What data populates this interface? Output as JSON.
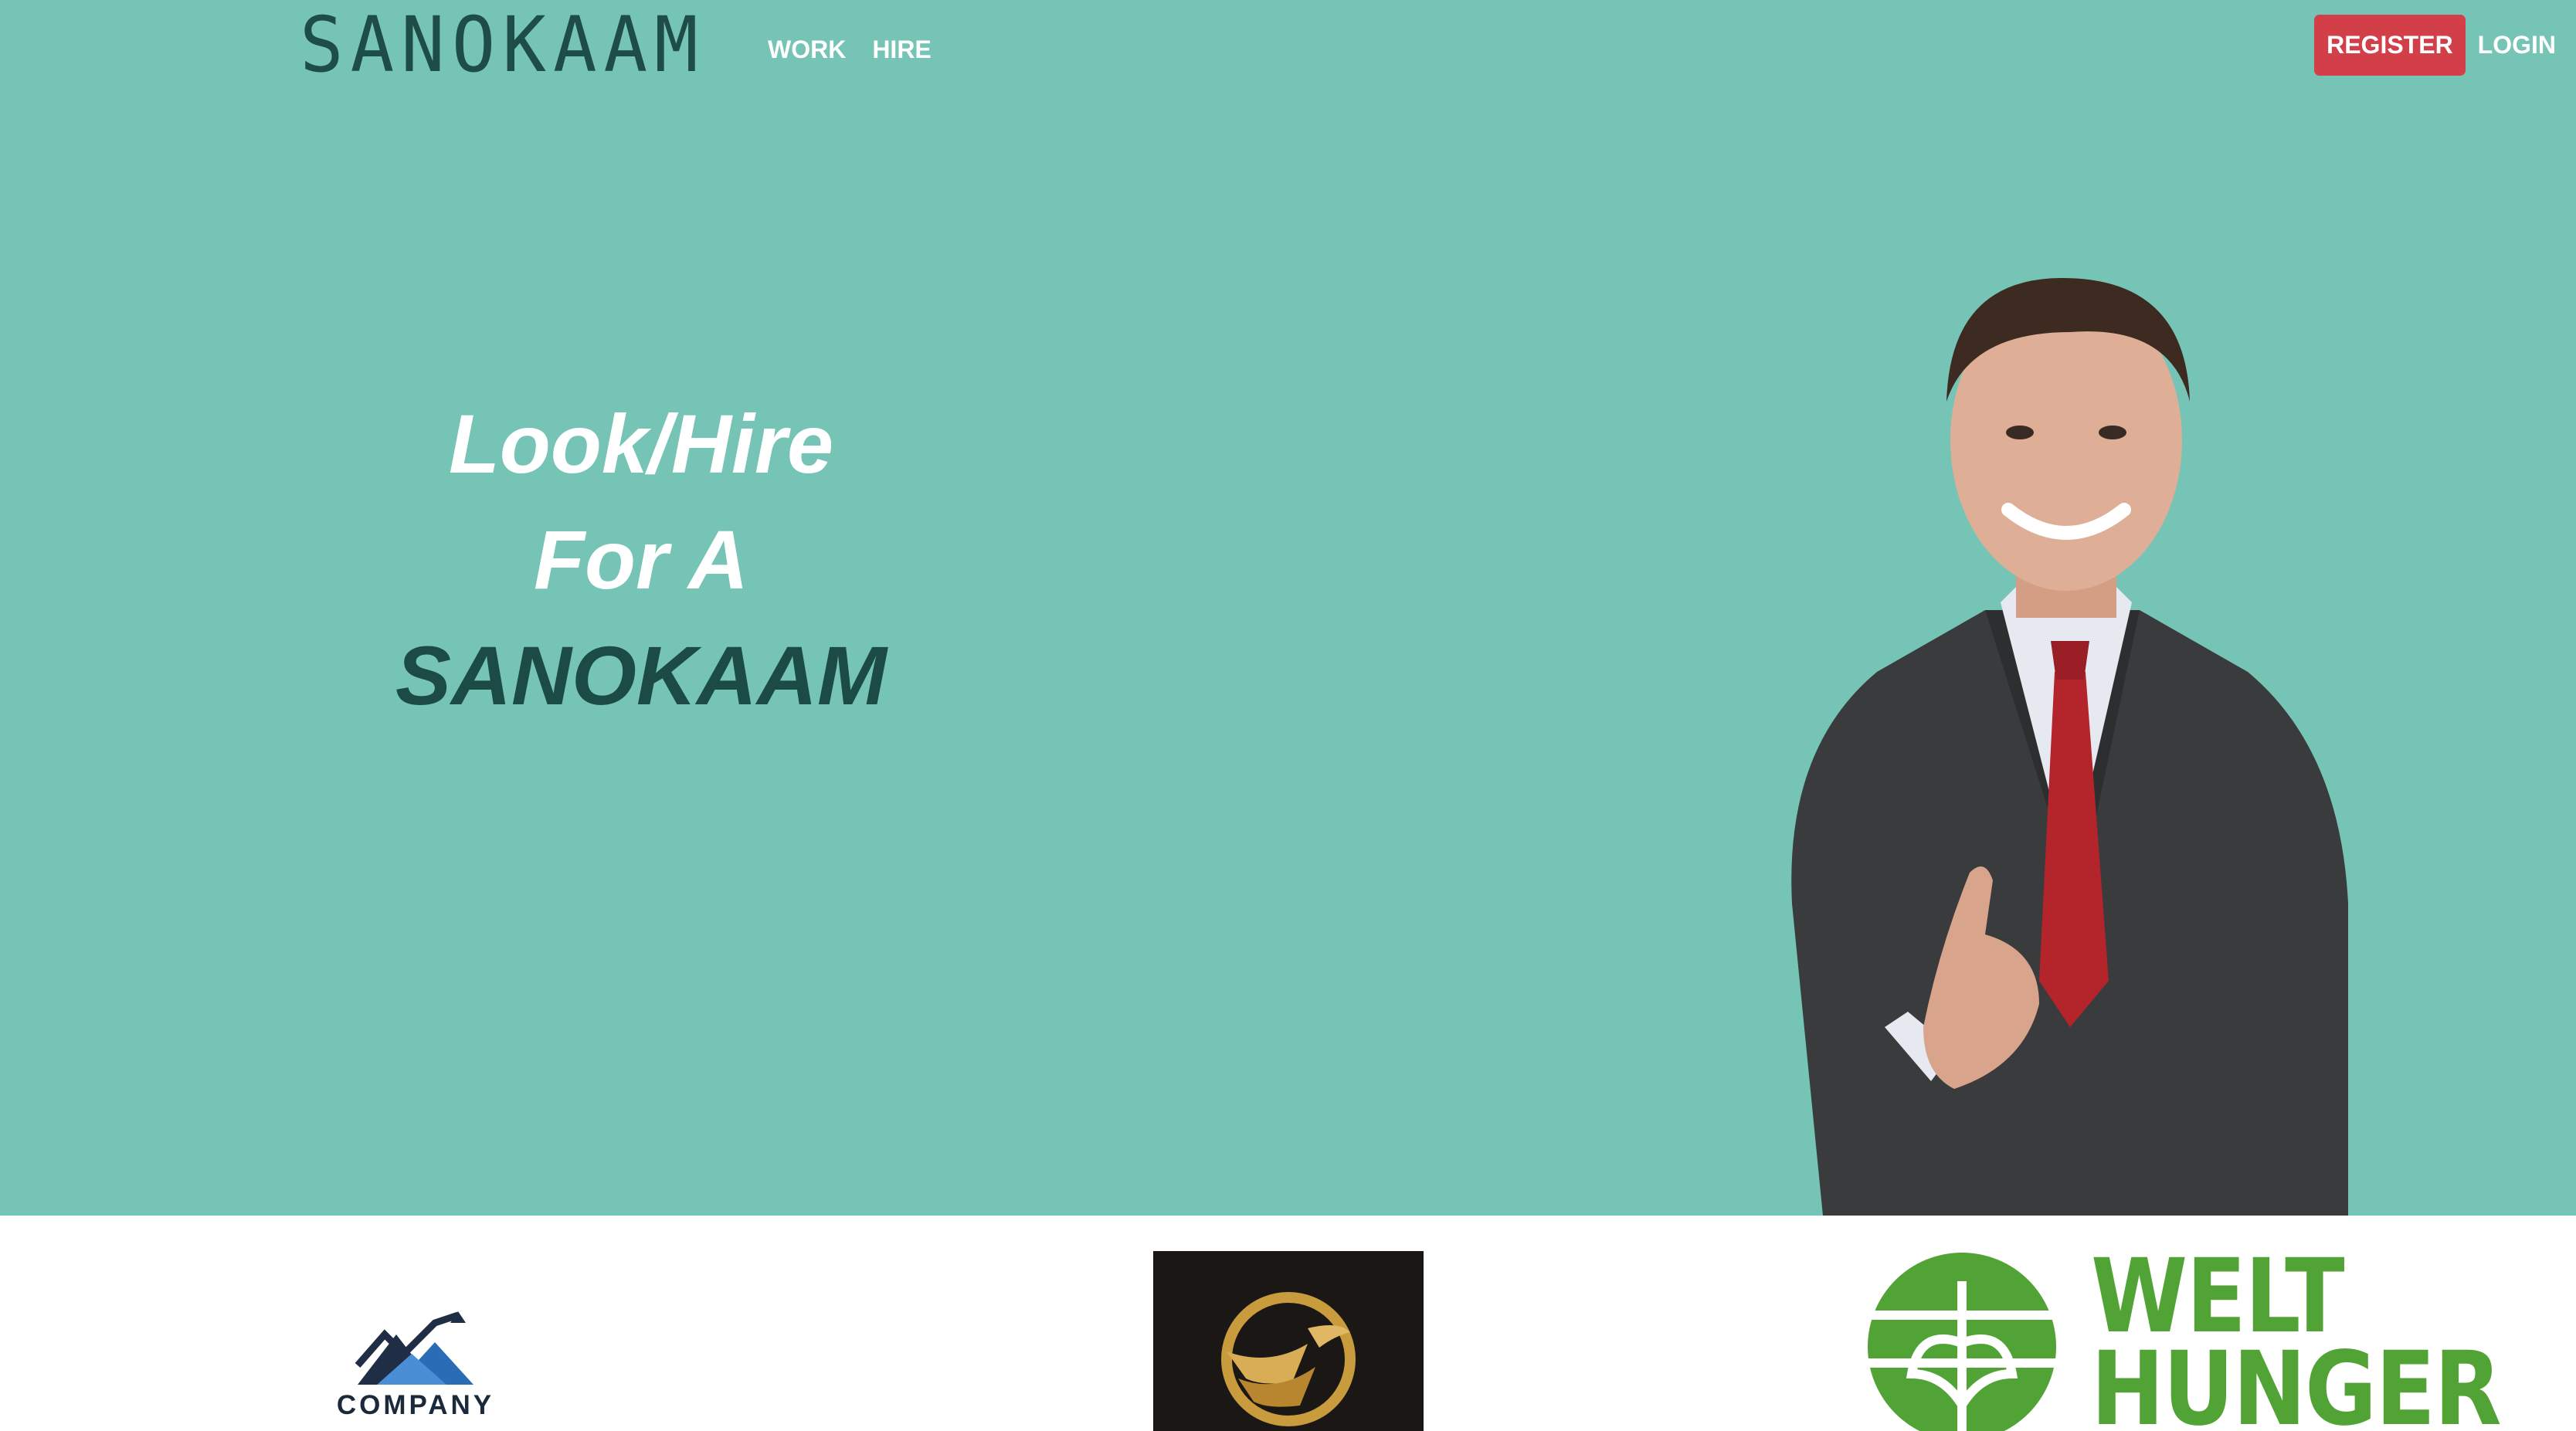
{
  "header": {
    "brand": "SANOKAAM",
    "nav": [
      "WORK",
      "HIRE"
    ],
    "register_label": "REGISTER",
    "login_label": "LOGIN"
  },
  "hero": {
    "line1": "Look/Hire",
    "line2": "For A",
    "line3": "SANOKAAM",
    "image": "smiling-businessman-handshake"
  },
  "partners": [
    {
      "name": "company-logo",
      "text": "COMPANY"
    },
    {
      "name": "gold-emblem-logo"
    },
    {
      "name": "welthungerhilfe-logo",
      "text_line1": "WELT",
      "text_line2": "HUNGER"
    }
  ],
  "colors": {
    "hero_bg": "#76c4b6",
    "brand_dark": "#1e4d47",
    "register_red": "#d33f49",
    "welt_green": "#52a336"
  }
}
